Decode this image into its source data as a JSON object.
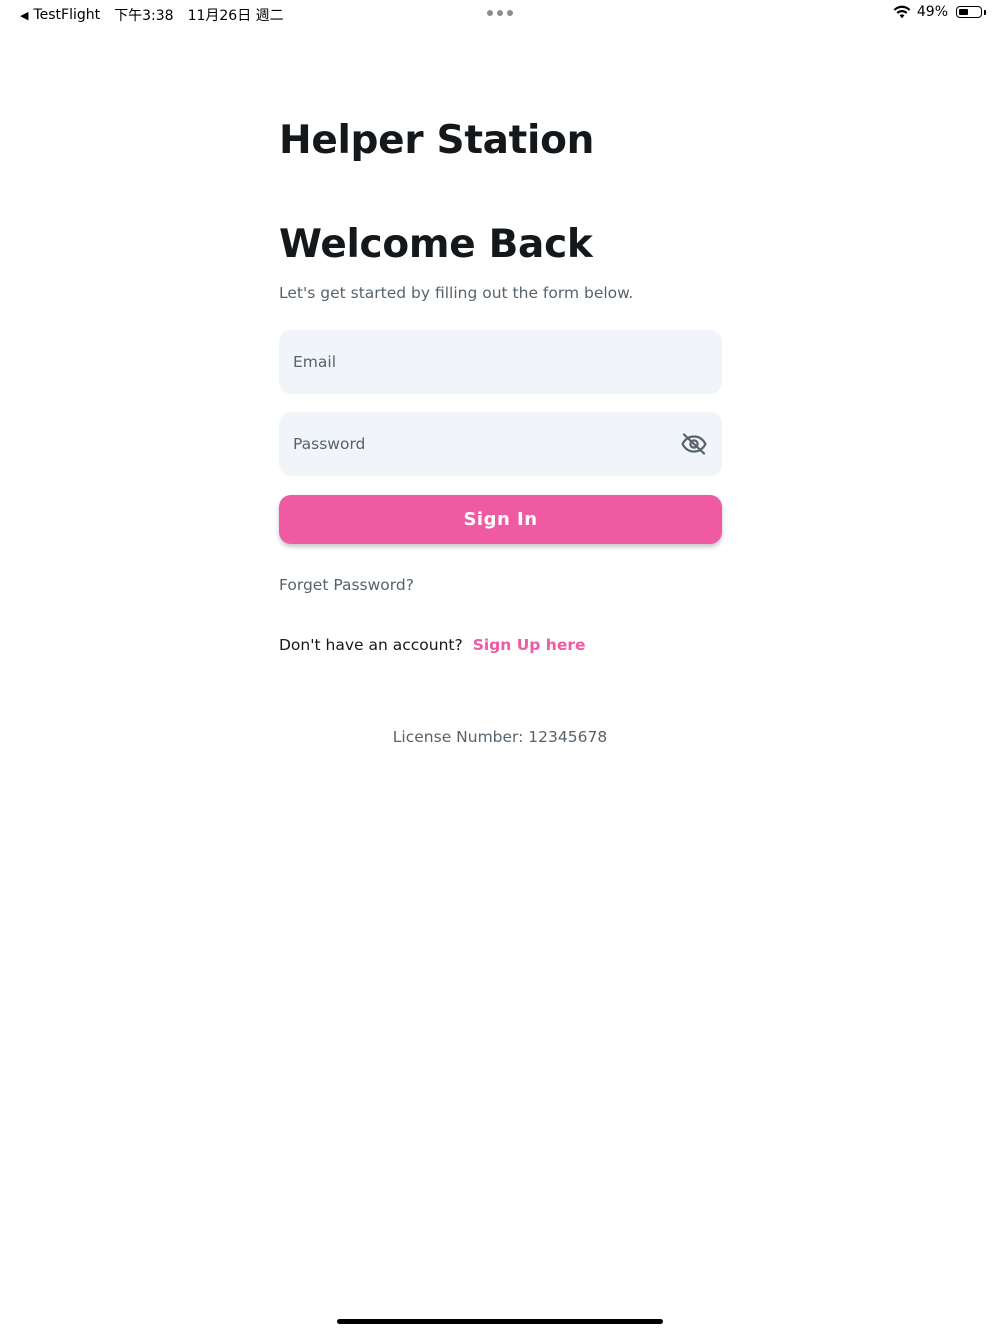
{
  "status_bar": {
    "back_app": "TestFlight",
    "time": "下午3:38",
    "date": "11月26日 週二",
    "battery_text": "49%",
    "battery_level": 0.49
  },
  "app": {
    "title": "Helper Station"
  },
  "form": {
    "heading": "Welcome Back",
    "subtitle": "Let's get started by filling out the form below.",
    "email_placeholder": "Email",
    "email_value": "",
    "password_placeholder": "Password",
    "password_value": "",
    "password_toggle_icon": "eye-off-icon",
    "signin_label": "Sign In",
    "forget_label": "Forget Password?",
    "signup_prompt": "Don't have an account?",
    "signup_link": "Sign Up here"
  },
  "footer": {
    "license": "License Number: 12345678"
  },
  "colors": {
    "accent": "#f05aa2",
    "field_bg": "#f1f4f8",
    "primary_text": "#14181b",
    "secondary_text": "#57636c"
  }
}
